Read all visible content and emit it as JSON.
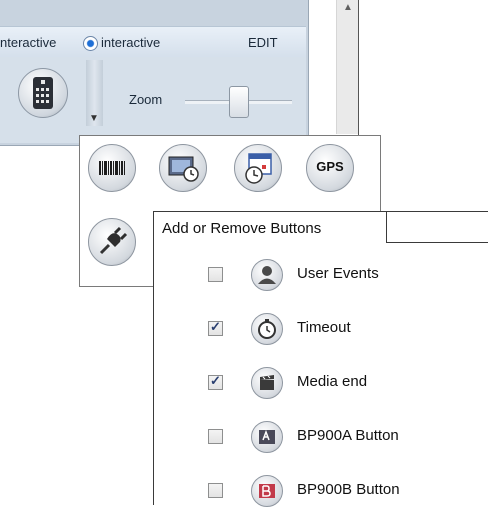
{
  "toolbar": {
    "radio_left_label": "nteractive",
    "radio_right_label": "interactive",
    "edit_label": "EDIT",
    "zoom_label": "Zoom"
  },
  "icons": {
    "remote": "remote-control-icon",
    "barcode": "barcode-icon",
    "media_timer": "media-timer-icon",
    "calendar_clock": "calendar-clock-icon",
    "gps": "GPS",
    "plug": "plug-icon"
  },
  "menu": {
    "title": "Add or Remove Buttons",
    "items": [
      {
        "label": "User Events",
        "checked": false,
        "icon": "user-icon"
      },
      {
        "label": "Timeout",
        "checked": true,
        "icon": "stopwatch-icon"
      },
      {
        "label": "Media end",
        "checked": true,
        "icon": "film-clapper-icon"
      },
      {
        "label": "BP900A Button",
        "checked": false,
        "icon": "bp900a-icon"
      },
      {
        "label": "BP900B Button",
        "checked": false,
        "icon": "bp900b-icon"
      }
    ]
  },
  "colors": {
    "panel": "#c8d3df",
    "accent_blue": "#1e6fd6"
  }
}
